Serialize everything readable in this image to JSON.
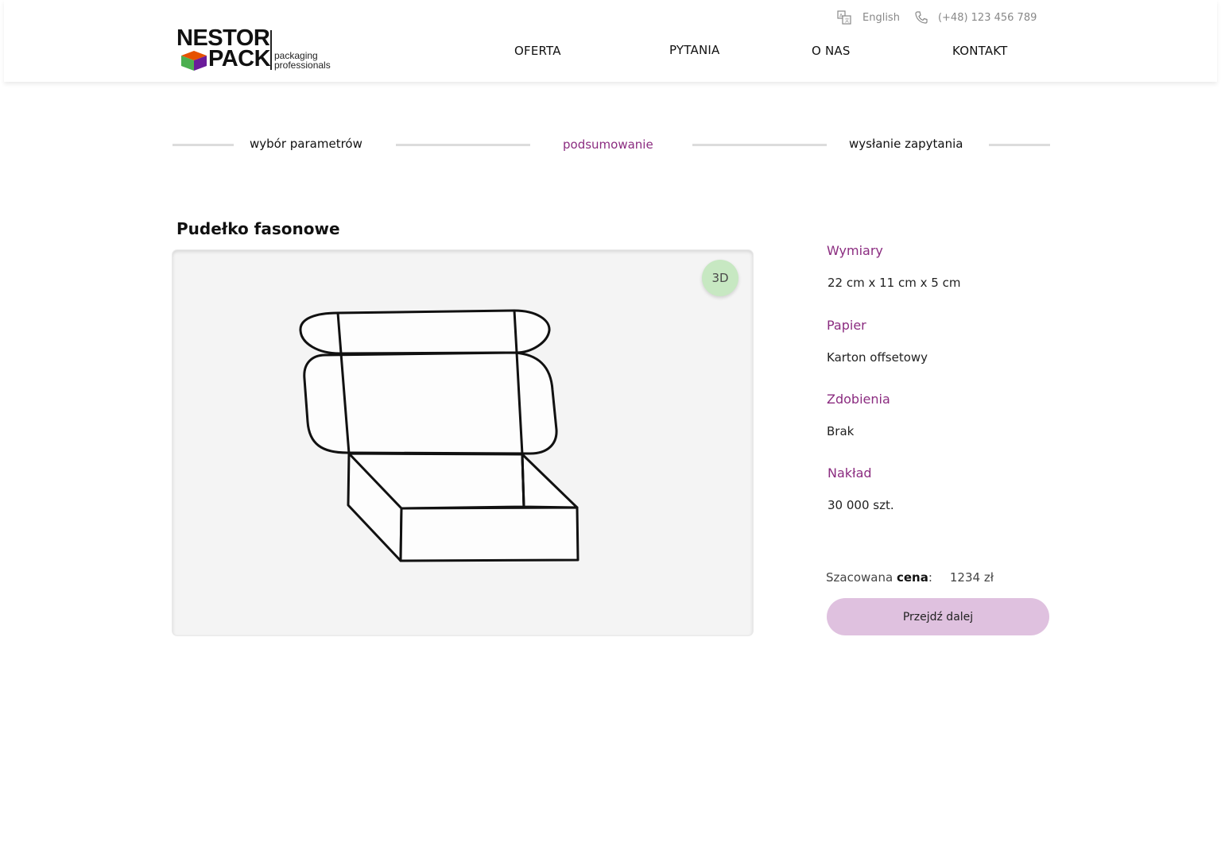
{
  "brand": {
    "name_line1": "NESTOR",
    "name_line2": "PACK",
    "tagline_line1": "packaging",
    "tagline_line2": "professionals"
  },
  "topbar": {
    "language": "English",
    "language_icon": "translate-icon",
    "phone": "(+48) 123 456 789",
    "phone_icon": "phone-icon"
  },
  "nav": {
    "items": [
      {
        "label": "OFERTA"
      },
      {
        "label": "PYTANIA"
      },
      {
        "label": "O NAS"
      },
      {
        "label": "KONTAKT"
      }
    ]
  },
  "steps": [
    {
      "label": "wybór parametrów",
      "active": false
    },
    {
      "label": "podsumowanie",
      "active": true
    },
    {
      "label": "wysłanie zapytania",
      "active": false
    }
  ],
  "product": {
    "title": "Pudełko fasonowe",
    "badge": "3D"
  },
  "specs": [
    {
      "label": "Wymiary",
      "value": "22 cm x 11 cm x 5 cm"
    },
    {
      "label": "Papier",
      "value": "Karton offsetowy"
    },
    {
      "label": "Zdobienia",
      "value": "Brak"
    },
    {
      "label": "Nakład",
      "value": "30 000 szt."
    }
  ],
  "price": {
    "prefix": "Szacowana ",
    "bold": "cena",
    "suffix": ":",
    "amount": "1234 zł"
  },
  "cta_label": "Przejdź dalej",
  "colors": {
    "accent": "#8b2c80",
    "cta_bg": "#dfc1df",
    "badge_bg": "#c7e8c2",
    "preview_bg": "#f4f4f4"
  }
}
